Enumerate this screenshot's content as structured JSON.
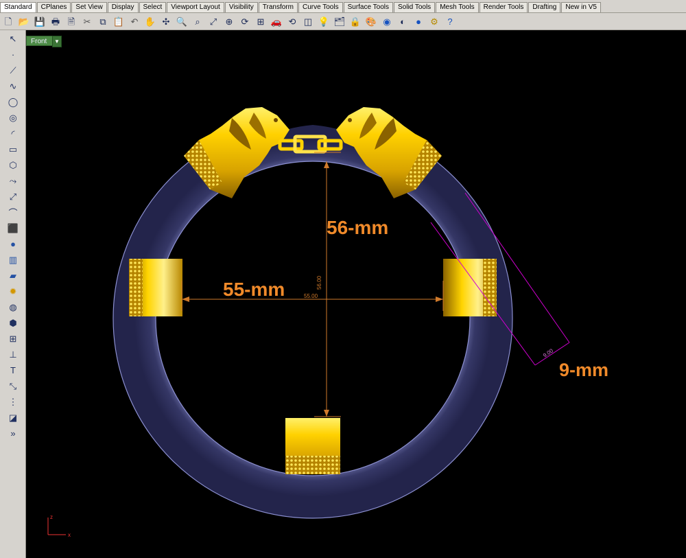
{
  "tabs": [
    "Standard",
    "CPlanes",
    "Set View",
    "Display",
    "Select",
    "Viewport Layout",
    "Visibility",
    "Transform",
    "Curve Tools",
    "Surface Tools",
    "Solid Tools",
    "Mesh Tools",
    "Render Tools",
    "Drafting",
    "New in V5"
  ],
  "viewport": {
    "label": "Front",
    "dropdown_glyph": "▼"
  },
  "dimensions": {
    "height": "56-mm",
    "height_value": "56.00",
    "width": "55-mm",
    "width_value": "55.00",
    "thickness": "9-mm",
    "thickness_value": "9.00"
  },
  "axis": {
    "x": "x",
    "z": "z"
  },
  "icons": {
    "toolbar": [
      "new-icon",
      "open-icon",
      "save-icon",
      "print-icon",
      "properties-icon",
      "cut-icon",
      "copy-icon",
      "paste-icon",
      "undo-icon",
      "pan-hand-icon",
      "move-icon",
      "zoom-icon",
      "zoom-window-icon",
      "zoom-extents-icon",
      "zoom-selected-icon",
      "rotate-view-icon",
      "four-viewports-icon",
      "car-icon",
      "rotate-cube-icon",
      "wireframe-icon",
      "light-icon",
      "layers-icon",
      "lock-icon",
      "render-icon",
      "color-icon",
      "shade-icon",
      "sphere-icon",
      "settings-icon",
      "help-icon"
    ],
    "sidebar": [
      "select-arrow-icon",
      "point-icon",
      "polyline-icon",
      "curve-icon",
      "circle-icon",
      "ellipse-icon",
      "arc-icon",
      "rectangle-icon",
      "polygon-icon",
      "offset-curve-icon",
      "extend-icon",
      "fillet-icon",
      "box-icon",
      "sphere-icon",
      "cylinder-icon",
      "surface-icon",
      "explode-icon",
      "boolean-icon",
      "solid-icon",
      "mesh-icon",
      "dimension-icon",
      "text-icon",
      "transform-icon",
      "array-icon",
      "rebuild-icon",
      "more-icon"
    ]
  }
}
